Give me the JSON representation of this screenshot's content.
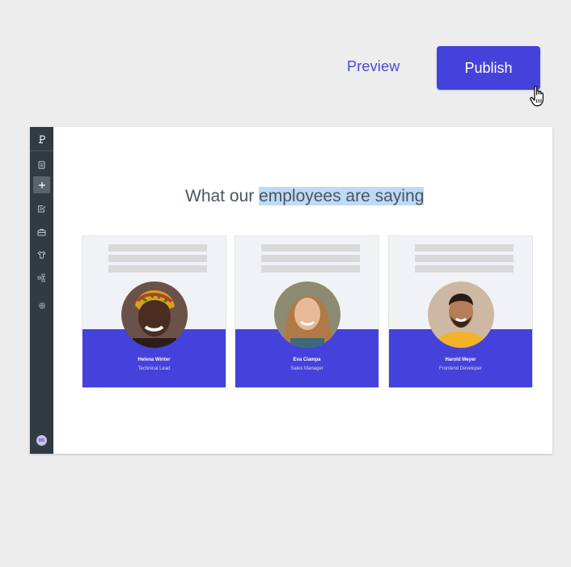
{
  "header": {
    "preview_label": "Preview",
    "publish_label": "Publish"
  },
  "colors": {
    "accent": "#4541db",
    "sidebar_bg": "#323a42",
    "selection_highlight": "#bfdaf7"
  },
  "sidebar": {
    "logo": "p-logo-icon",
    "items": [
      {
        "icon": "page-icon",
        "active": false
      },
      {
        "icon": "plus-icon",
        "active": true
      },
      {
        "icon": "edit-icon",
        "active": false
      },
      {
        "icon": "briefcase-icon",
        "active": false
      },
      {
        "icon": "shirt-icon",
        "active": false
      },
      {
        "icon": "integrations-icon",
        "active": false
      },
      {
        "icon": "gear-icon",
        "active": false
      }
    ],
    "user_initials": "MS"
  },
  "canvas": {
    "title_plain": "What our",
    "title_selected": "employees are saying",
    "cards": [
      {
        "name": "Helena Winter",
        "role": "Technical Lead"
      },
      {
        "name": "Eva Ciampa",
        "role": "Sales Manager"
      },
      {
        "name": "Harold Meyer",
        "role": "Frontend Developer"
      }
    ]
  }
}
